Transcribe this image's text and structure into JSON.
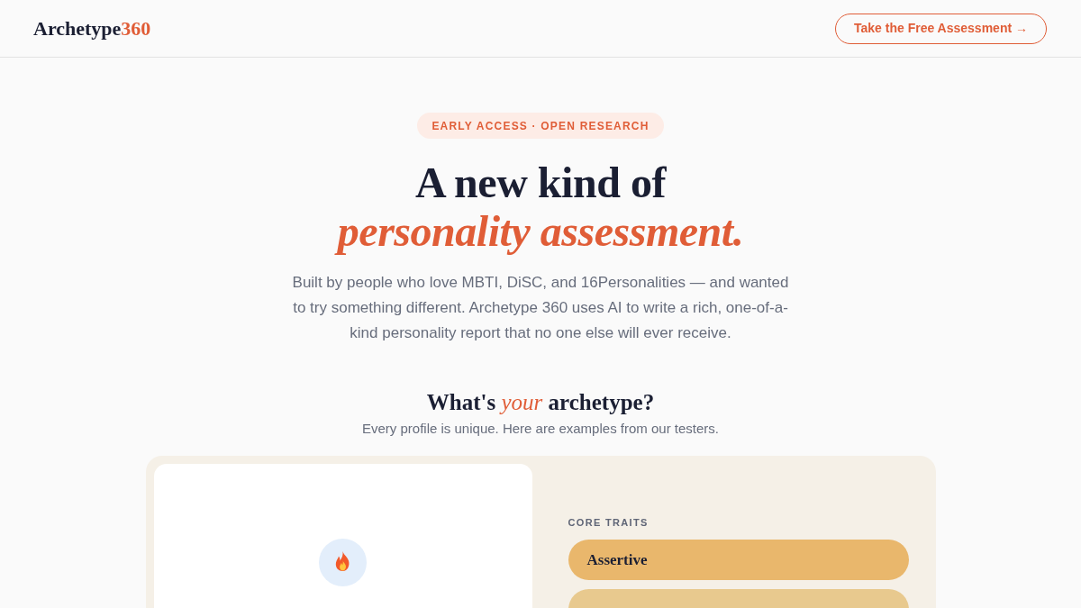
{
  "header": {
    "logo": {
      "name": "Archetype",
      "accent": "360"
    },
    "cta": "Take the Free Assessment →"
  },
  "hero": {
    "badge": "EARLY ACCESS · OPEN RESEARCH",
    "title_line1": "A new kind of",
    "title_line2": "personality assessment.",
    "description": "Built by people who love MBTI, DiSC, and 16Personalities — and wanted to try something different. Archetype 360 uses AI to write a rich, one-of-a-kind personality report that no one else will ever receive."
  },
  "examples": {
    "heading": "What's *your* archetype?",
    "subheading": "Every profile is unique. Here are examples from our testers.",
    "traits": {
      "label": "CORE TRAITS",
      "items": [
        {
          "label": "Assertive",
          "color": "#e9b76c"
        },
        {
          "color": "#e8c98e"
        }
      ]
    }
  }
}
